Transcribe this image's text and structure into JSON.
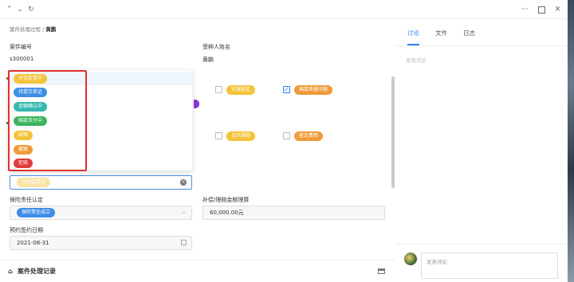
{
  "topbar": {
    "back_icon": "chevron-up-icon",
    "down_icon": "chevron-down-icon",
    "refresh_icon": "refresh-icon",
    "more_icon": "more-icon",
    "panel_icon": "panel-icon",
    "close_icon": "close-icon"
  },
  "breadcrumb": {
    "parent": "案件处理过程",
    "sep": "/",
    "current": "黄鹏"
  },
  "fields": {
    "case_no_label": "案件编号",
    "case_no_value": "s300001",
    "insured_label": "受种人姓名",
    "insured_value": "黄鹏",
    "checkbox_tags": [
      {
        "label": "实施鉴定",
        "color": "#f4c33a",
        "checked": false
      },
      {
        "label": "箱苗质量问题",
        "color": "#f09a3a",
        "checked": true
      },
      {
        "label": "日间课程",
        "color": "#f4c33a",
        "checked": false
      },
      {
        "label": "鉴定费用",
        "color": "#f09a3a",
        "checked": false
      }
    ],
    "status_select_value": "评估定责中",
    "liability_label": "保险责任认定",
    "liability_value": "保险责任成立",
    "comp_label": "补偿/理赔金额理算",
    "comp_value": "60,000.00元",
    "date_label": "预约签约日期",
    "date_value": "2021-08-31",
    "bottom_label": "案件处理记录"
  },
  "dropdown": {
    "options": [
      {
        "label": "评估定责中",
        "color": "#f4c33a"
      },
      {
        "label": "待提交单证",
        "color": "#3f8ee8"
      },
      {
        "label": "金额确认中",
        "color": "#35b8b0"
      },
      {
        "label": "赔款支付中",
        "color": "#3cb45c"
      },
      {
        "label": "结案",
        "color": "#f4c33a"
      },
      {
        "label": "撤案",
        "color": "#f09a3a"
      },
      {
        "label": "拒赔",
        "color": "#e03a3a"
      }
    ]
  },
  "right": {
    "tabs": [
      "讨论",
      "文件",
      "日志"
    ],
    "comment_placeholder": "发布评论",
    "input_placeholder": "发表评论"
  },
  "colors": {
    "accent": "#2d7ef7",
    "highlight": "#e03030"
  }
}
